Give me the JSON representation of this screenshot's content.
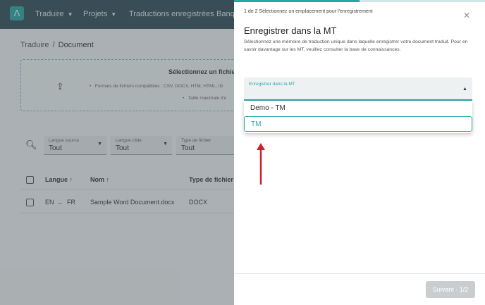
{
  "nav": {
    "items": [
      {
        "label": "Traduire",
        "chevron": true
      },
      {
        "label": "Projets",
        "chevron": true
      },
      {
        "label": "Traductions enregistrées",
        "chevron": false
      },
      {
        "label": "Banq",
        "chevron": false
      }
    ]
  },
  "breadcrumb": {
    "root": "Traduire",
    "separator": "/",
    "current": "Document"
  },
  "upload": {
    "title": "Sélectionnez un fichier, c",
    "formats": "Formats de fichiers compatibles : CSV, DOCX, HTM, HTML, ID",
    "max_size": "Taille maximale d'u"
  },
  "filters": [
    {
      "label": "Langue source",
      "value": "Tout"
    },
    {
      "label": "Langue cible",
      "value": "Tout"
    },
    {
      "label": "Type de fichier",
      "value": "Tout"
    }
  ],
  "table": {
    "headers": {
      "language": "Langue",
      "name": "Nom",
      "file_type": "Type de fichier"
    },
    "rows": [
      {
        "source": "EN",
        "target": "FR",
        "name": "Sample Word Document.docx",
        "type": "DOCX"
      }
    ]
  },
  "drawer": {
    "step": "1 de 2 Sélectionnez un emplacement pour l'enregistrement",
    "progress": 0.5,
    "title": "Enregistrer dans la MT",
    "description": "Sélectionnez une mémoire de traduction unique dans laquelle enregistrer votre document traduit. Pour en savoir davantage sur les MT, veuillez consulter la base de connaissances.",
    "select_label": "Enregistrer dans la MT",
    "options": [
      "Demo - TM",
      "TM"
    ],
    "highlighted_option": "TM",
    "next_button": "Suivant · 1/2"
  },
  "colors": {
    "accent": "#29a7a4",
    "topbar": "#2f4a56",
    "arrow": "#c8242c"
  }
}
